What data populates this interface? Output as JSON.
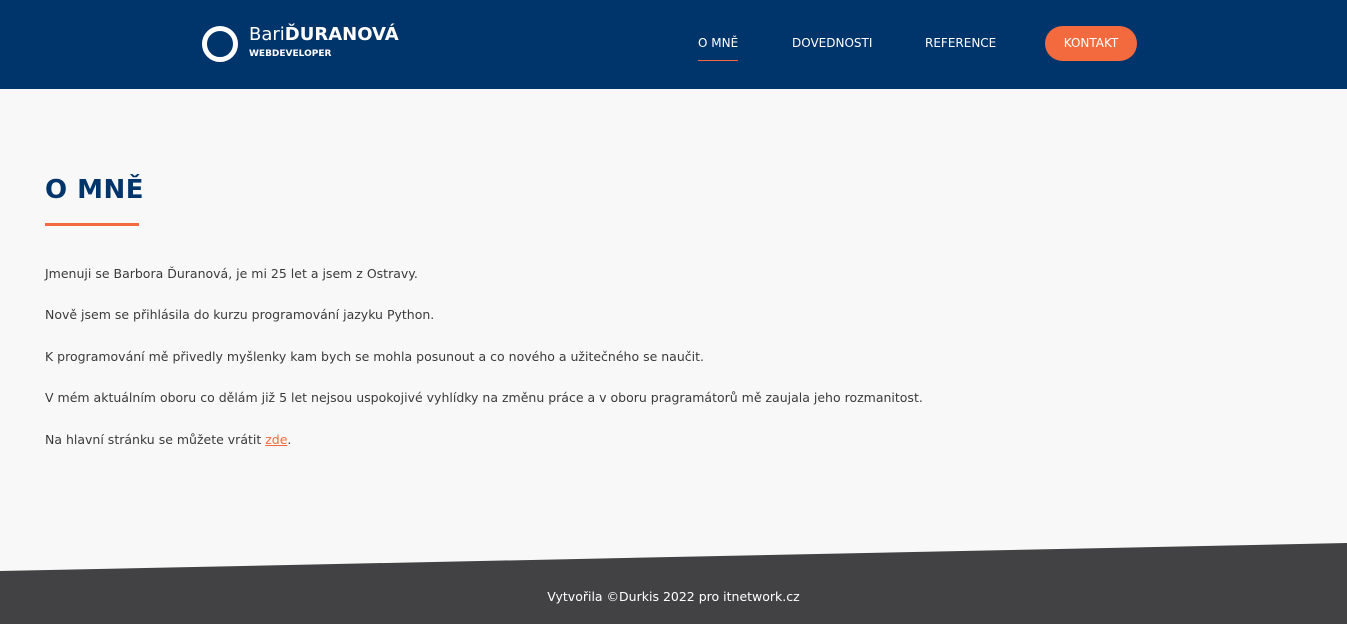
{
  "header": {
    "logo": {
      "first_name": "Bari",
      "last_name": "ĎURANOVÁ",
      "subtitle": "WEBDEVELOPER"
    },
    "nav": {
      "about": "O MNĚ",
      "skills": "DOVEDNOSTI",
      "references": "REFERENCE",
      "contact": "KONTAKT"
    },
    "active_nav": "about"
  },
  "main": {
    "title": "O MNĚ",
    "paragraphs": [
      "Jmenuji se Barbora Ďuranová, je mi 25 let a jsem z Ostravy.",
      "Nově jsem se přihlásila do kurzu programování jazyku Python.",
      "K programování mě přivedly myšlenky kam bych se mohla posunout a co nového a užitečného se naučit.",
      "V mém aktuálním oboru co dělám již 5 let nejsou uspokojivé vyhlídky na změnu práce a v oboru pragramátorů mě zaujala jeho rozmanitost."
    ],
    "back_text": "Na hlavní stránku se můžete vrátit ",
    "back_link": "zde",
    "back_suffix": "."
  },
  "footer": {
    "text": "Vytvořila ©Durkis 2022 pro itnetwork.cz"
  },
  "colors": {
    "header_bg": "#00356b",
    "accent": "#f26a3d",
    "page_bg": "#f8f8f8",
    "footer_bg": "#424244",
    "title": "#00356b"
  }
}
